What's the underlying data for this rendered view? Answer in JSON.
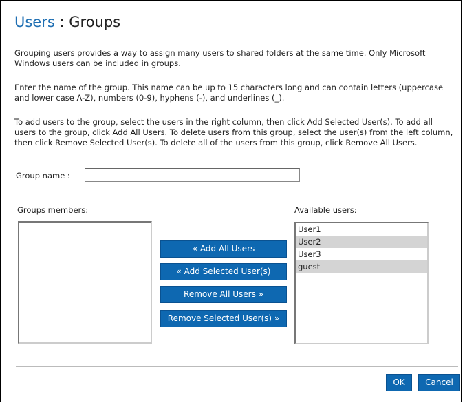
{
  "header": {
    "breadcrumb": "Users",
    "separator": " : ",
    "current": "Groups"
  },
  "instructions": {
    "p1": "Grouping users provides a way to assign many users to shared folders at the same time. Only Microsoft Windows users can be included in groups.",
    "p2": "Enter the name of the group. This name can be up to 15 characters long and can contain letters (uppercase and lower case A-Z), numbers (0-9), hyphens (-), and underlines (_).",
    "p3": "To add users to the group, select the users in the right column, then click Add Selected User(s). To add all users to the group, click Add All Users. To delete users from this group, select the user(s) from the left column, then click Remove Selected User(s). To delete all of the users from this group, click Remove All Users."
  },
  "group_name": {
    "label": "Group name   :",
    "value": "",
    "placeholder": ""
  },
  "members": {
    "label": "Groups members:",
    "items": []
  },
  "available": {
    "label": "Available users:",
    "items": [
      "User1",
      "User2",
      "User3",
      "guest"
    ]
  },
  "actions": {
    "add_all": "« Add All Users",
    "add_selected": "« Add Selected User(s)",
    "remove_all": "Remove All Users »",
    "remove_selected": "Remove Selected User(s) »"
  },
  "footer": {
    "ok": "OK",
    "cancel": "Cancel"
  },
  "colors": {
    "accent": "#0e68b1",
    "breadcrumb": "#1f6fb3",
    "alt_row": "#d4d4d4"
  }
}
